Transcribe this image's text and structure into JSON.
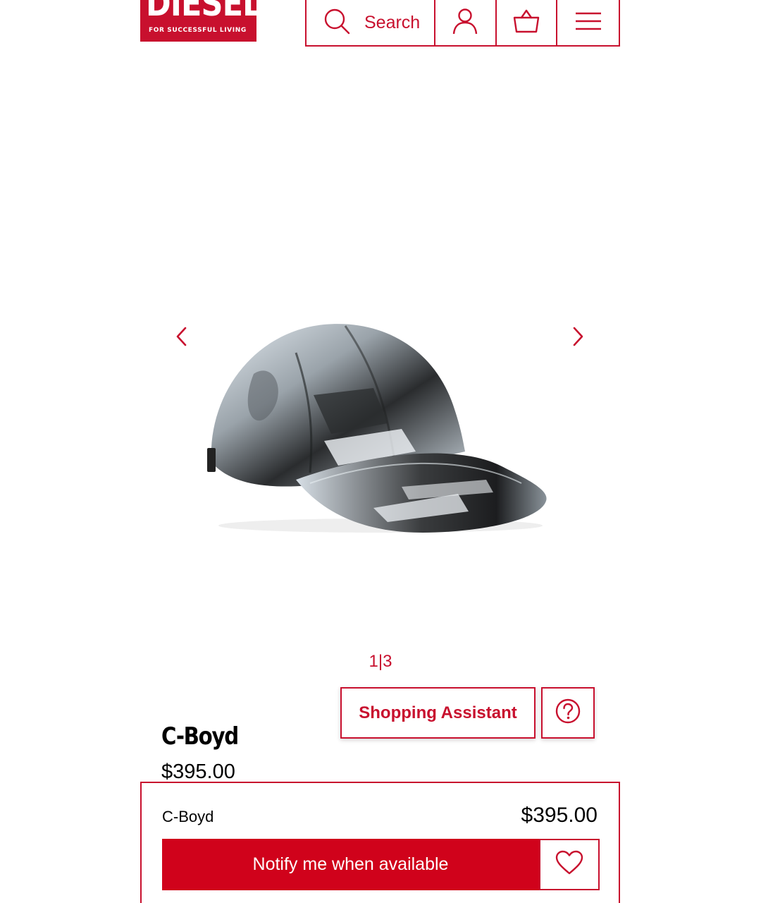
{
  "brand": {
    "name": "DIESEL",
    "tagline": "FOR SUCCESSFUL LIVING",
    "color": "#c8102e"
  },
  "header": {
    "search_label": "Search",
    "icons": [
      "search-icon",
      "user-icon",
      "basket-icon",
      "menu-icon"
    ]
  },
  "gallery": {
    "current": "1",
    "separator": "|",
    "total": "3",
    "prev_icon": "chevron-left-icon",
    "next_icon": "chevron-right-icon"
  },
  "assistant": {
    "label": "Shopping Assistant",
    "help_icon": "question-circle-icon"
  },
  "product": {
    "name": "C-Boyd",
    "price": "$395.00"
  },
  "sticky_bar": {
    "name": "C-Boyd",
    "price": "$395.00",
    "notify_label": "Notify me when available",
    "wishlist_icon": "heart-icon",
    "button_color": "#d0021b"
  }
}
